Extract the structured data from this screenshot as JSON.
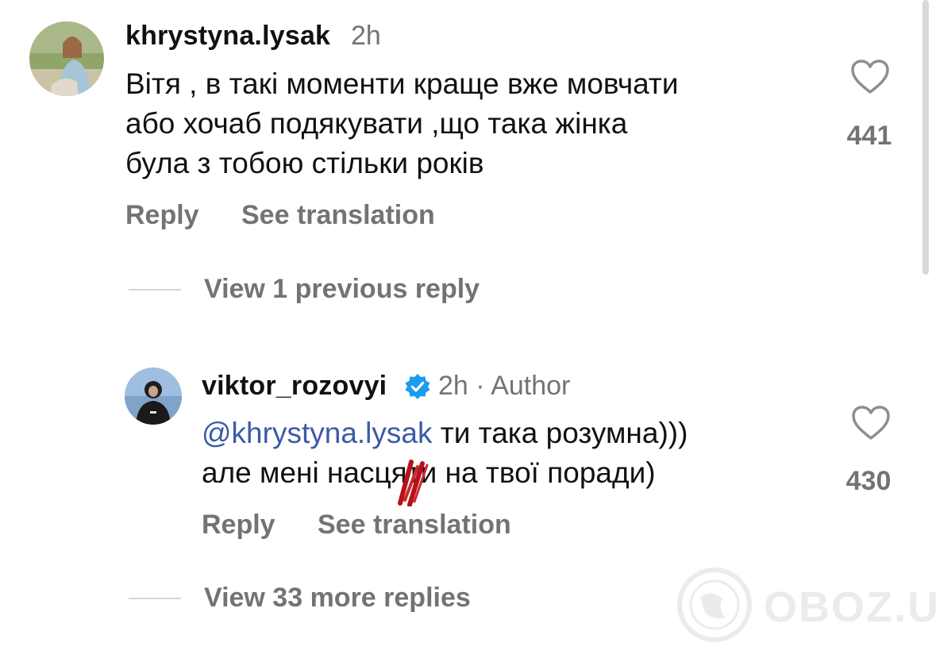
{
  "comments": [
    {
      "username": "khrystyna.lysak",
      "time": "2h",
      "lines": [
        "Вітя , в такі моменти краще вже мовчати",
        "або хочаб подякувати ,що така жінка",
        "була з тобою стільки років"
      ],
      "likes": "441",
      "reply_label": "Reply",
      "translate_label": "See translation",
      "avatar_icon": "profile-photo-woman"
    },
    {
      "username": "viktor_rozovyi",
      "verified": true,
      "time": "2h",
      "separator": "·",
      "author_label": "Author",
      "mention": "@khrystyna.lysak",
      "line1_rest": " ти така розумна)))",
      "line2": "але мені насцяти на твої поради)",
      "likes": "430",
      "reply_label": "Reply",
      "translate_label": "See translation",
      "avatar_icon": "profile-photo-man"
    }
  ],
  "view_previous": "View 1 previous reply",
  "view_more": "View 33 more replies",
  "watermark": {
    "text": "OBOZ.UA",
    "icon": "globe-logo-icon"
  },
  "colors": {
    "text": "#111111",
    "secondary": "#737373",
    "mention": "#3b5aa8",
    "verified": "#1d9bf0",
    "redaction": "#b5121b"
  }
}
